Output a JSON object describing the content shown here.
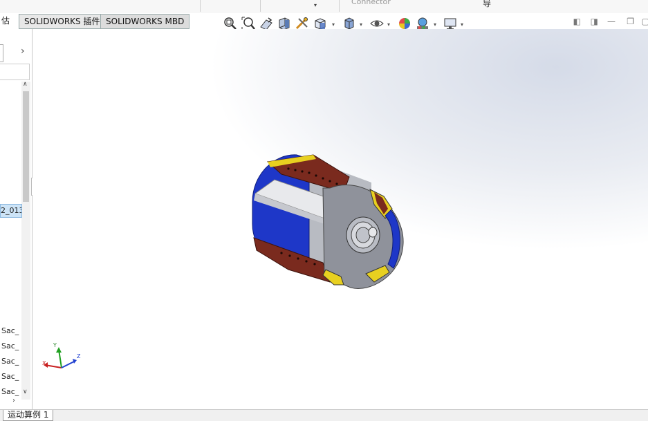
{
  "ribbon": {
    "connector_label": "Connector",
    "guide_label": "导",
    "dropdown_glyph": "▾"
  },
  "tabs": {
    "truncated": "估",
    "items": [
      "SOLIDWORKS 插件",
      "SOLIDWORKS MBD"
    ]
  },
  "view_toolbar": {
    "icons": [
      "zoom-to-fit-icon",
      "zoom-area-icon",
      "previous-view-icon",
      "section-view-icon",
      "dynamic-annotation-icon",
      "view-orientation-icon",
      "display-style-icon",
      "hide-show-items-icon",
      "edit-appearance-icon",
      "apply-scene-icon",
      "view-settings-icon"
    ]
  },
  "window_buttons": [
    "◧",
    "◨",
    "—",
    "❐",
    "▢"
  ],
  "left_panel": {
    "arrow": "›",
    "selected_item": "2_013",
    "items": [
      "Sac_",
      "Sac_",
      "Sac_",
      "Sac_",
      "Sac_"
    ],
    "scroll_up": "∧",
    "scroll_down": "∨",
    "more": "›"
  },
  "triad": {
    "x": "X",
    "y": "Y",
    "z": "Z"
  },
  "bottom_tab": "运动算例 1",
  "colors": {
    "blue": "#1e37c8",
    "brown": "#7a2a1e",
    "yellow": "#e8d020",
    "gray": "#9a9da6"
  }
}
